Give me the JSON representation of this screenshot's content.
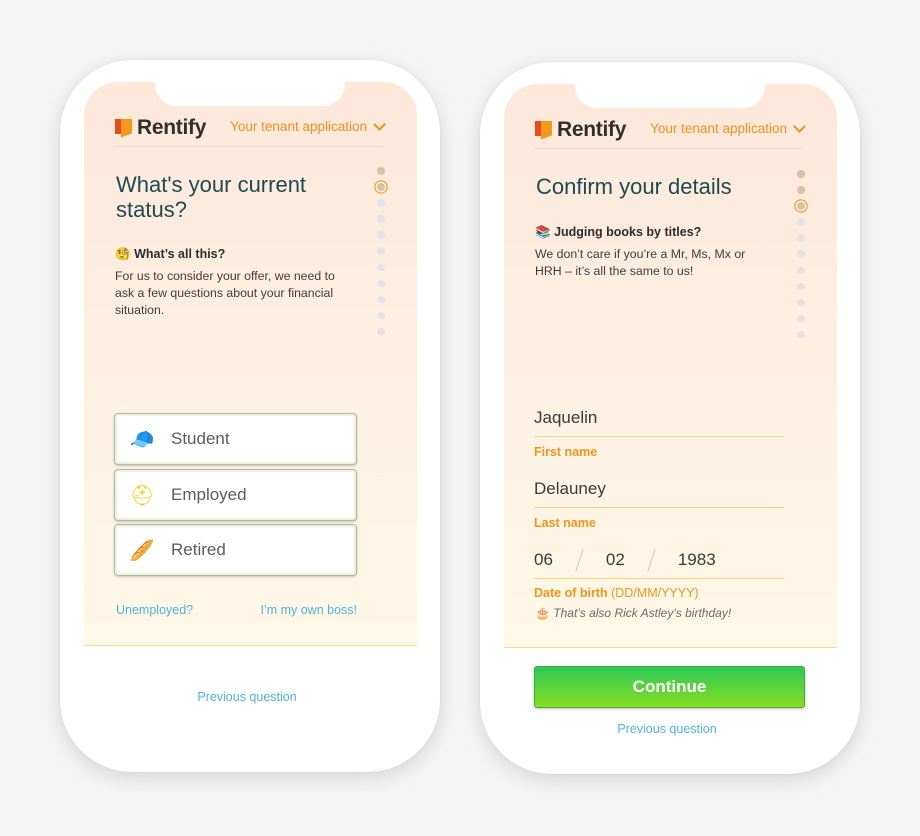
{
  "brand": {
    "name": "Rentify",
    "logo_colors": [
      "#e84c1e",
      "#f39a1b"
    ]
  },
  "colors": {
    "accent": "#f0901d",
    "link": "#4db3df",
    "title": "#1f4a55",
    "continue": "#3dce46"
  },
  "header": {
    "dropdown_label": "Your tenant application",
    "dropdown_icon": "chevron-down-icon"
  },
  "screen1": {
    "title": "What's your current status?",
    "help_emoji": "🧐",
    "help_heading": "What’s all this?",
    "help_text": "For us to consider your offer, we need to ask a few questions about your financial situation.",
    "progress": {
      "total_steps": 11,
      "current_step": 2
    },
    "options": [
      {
        "label": "Student",
        "icon": "propeller-cap-icon",
        "emoji": "🧢"
      },
      {
        "label": "Employed",
        "icon": "hard-hat-icon",
        "emoji": "⛑"
      },
      {
        "label": "Retired",
        "icon": "flat-cap-icon",
        "emoji": "🥖"
      }
    ],
    "alt_links": [
      "Unemployed?",
      "I’m my own boss!"
    ],
    "previous_label": "Previous question"
  },
  "screen2": {
    "title": "Confirm your details",
    "help_emoji": "📚",
    "help_heading": "Judging books by titles?",
    "help_text": "We don’t care if you’re a Mr, Ms, Mx or HRH – it’s all the same to us!",
    "progress": {
      "total_steps": 11,
      "current_step": 3
    },
    "first_name": {
      "value": "Jaquelin",
      "label": "First name"
    },
    "last_name": {
      "value": "Delauney",
      "label": "Last name"
    },
    "dob": {
      "day": "06",
      "month": "02",
      "year": "1983",
      "label": "Date of birth",
      "format_hint": "(DD/MM/YYYY)",
      "note_emoji": "🎂",
      "note": "That’s also Rick Astley’s birthday!"
    },
    "continue_label": "Continue",
    "previous_label": "Previous question"
  }
}
